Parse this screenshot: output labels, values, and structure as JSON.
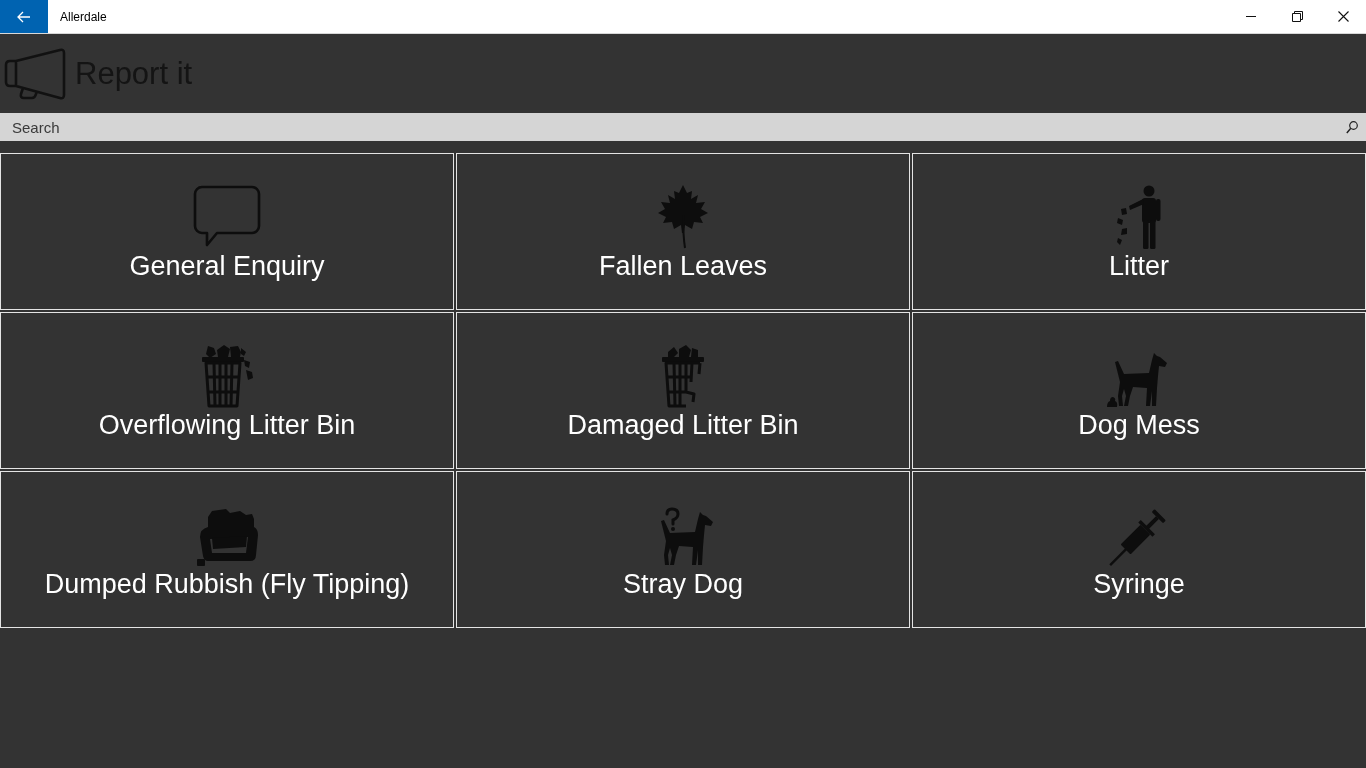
{
  "window": {
    "title": "Allerdale"
  },
  "header": {
    "title": "Report it"
  },
  "search": {
    "placeholder": "Search"
  },
  "categories": [
    {
      "label": "General Enquiry"
    },
    {
      "label": "Fallen Leaves"
    },
    {
      "label": "Litter"
    },
    {
      "label": "Overflowing Litter Bin"
    },
    {
      "label": "Damaged Litter Bin"
    },
    {
      "label": "Dog Mess"
    },
    {
      "label": "Dumped Rubbish (Fly Tipping)"
    },
    {
      "label": "Stray Dog"
    },
    {
      "label": "Syringe"
    }
  ]
}
